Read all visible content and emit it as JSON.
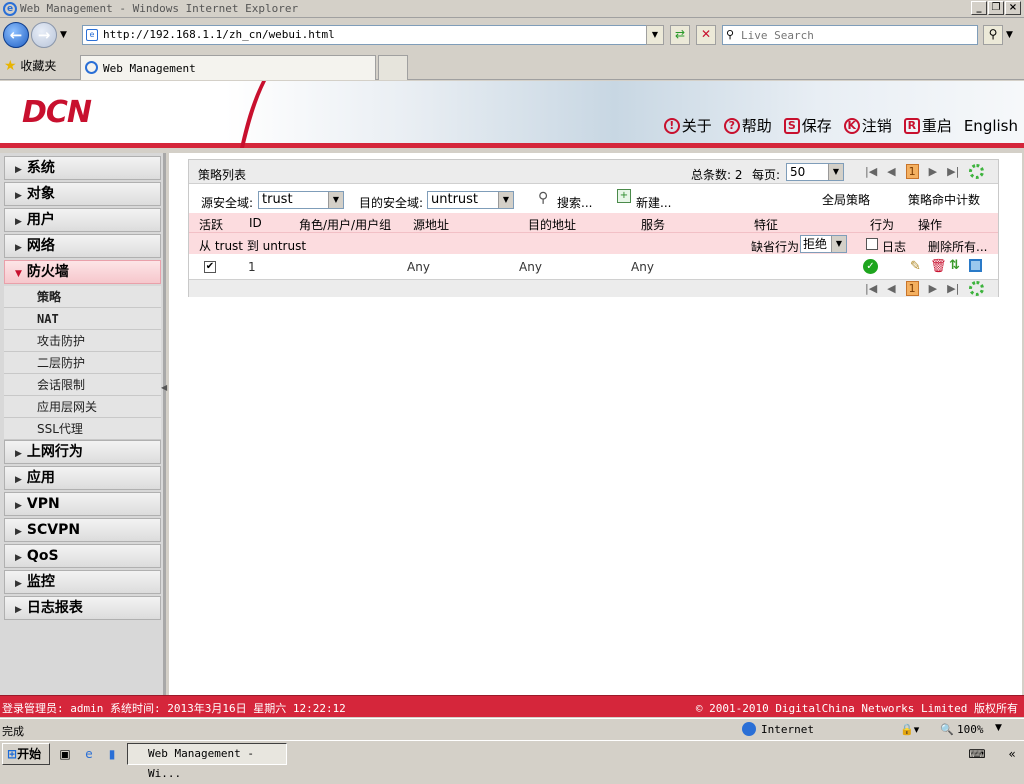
{
  "window": {
    "title": "Web Management - Windows Internet Explorer"
  },
  "browser": {
    "url": "http://192.168.1.1/zh_cn/webui.html",
    "search_placeholder": "Live Search",
    "favorites_label": "收藏夹",
    "tab_title": "Web Management"
  },
  "header": {
    "logo": "DCN",
    "links": [
      {
        "label": "关于",
        "icon": "!"
      },
      {
        "label": "帮助",
        "icon": "?"
      },
      {
        "label": "保存",
        "icon": "S"
      },
      {
        "label": "注销",
        "icon": "K"
      },
      {
        "label": "重启",
        "icon": "R"
      },
      {
        "label": "English",
        "icon": ""
      }
    ]
  },
  "sidebar": {
    "menus": [
      {
        "label": "系统"
      },
      {
        "label": "对象"
      },
      {
        "label": "用户"
      },
      {
        "label": "网络"
      },
      {
        "label": "防火墙"
      },
      {
        "label": "上网行为"
      },
      {
        "label": "应用"
      },
      {
        "label": "VPN"
      },
      {
        "label": "SCVPN"
      },
      {
        "label": "QoS"
      },
      {
        "label": "监控"
      },
      {
        "label": "日志报表"
      }
    ],
    "firewall_sub": [
      {
        "label": "策略"
      },
      {
        "label": "NAT"
      },
      {
        "label": "攻击防护"
      },
      {
        "label": "二层防护"
      },
      {
        "label": "会话限制"
      },
      {
        "label": "应用层网关"
      },
      {
        "label": "SSL代理"
      }
    ]
  },
  "policy": {
    "title": "策略列表",
    "total_label": "总条数: 2",
    "per_page_label": "每页:",
    "per_page_value": "50",
    "current_page": "1",
    "src_zone_label": "源安全域:",
    "src_zone_value": "trust",
    "dst_zone_label": "目的安全域:",
    "dst_zone_value": "untrust",
    "search_label": "搜索...",
    "new_label": "新建...",
    "global_policy_label": "全局策略",
    "hit_count_label": "策略命中计数",
    "columns": {
      "active": "活跃",
      "id": "ID",
      "role": "角色/用户/用户组",
      "src": "源地址",
      "dst": "目的地址",
      "service": "服务",
      "feature": "特征",
      "action": "行为",
      "operation": "操作"
    },
    "zone_text": "从 trust 到 untrust",
    "default_action_label": "缺省行为",
    "default_action_value": "拒绝",
    "log_label": "日志",
    "delete_all_label": "删除所有...",
    "rows": [
      {
        "active": "✔",
        "id": "1",
        "src": "Any",
        "dst": "Any",
        "service": "Any"
      }
    ]
  },
  "footer": {
    "login_info": "登录管理员: admin 系统时间: 2013年3月16日 星期六 12:22:12",
    "copyright": "© 2001-2010 DigitalChina Networks Limited 版权所有"
  },
  "statusbar": {
    "status": "完成",
    "zone": "Internet",
    "zoom": "100%"
  },
  "taskbar": {
    "start": "开始",
    "task_item": "Web Management - Wi..."
  },
  "colors": {
    "brand_red": "#d5263b",
    "menu_active": "#f6c7cc",
    "table_header": "#fcdcdf"
  }
}
